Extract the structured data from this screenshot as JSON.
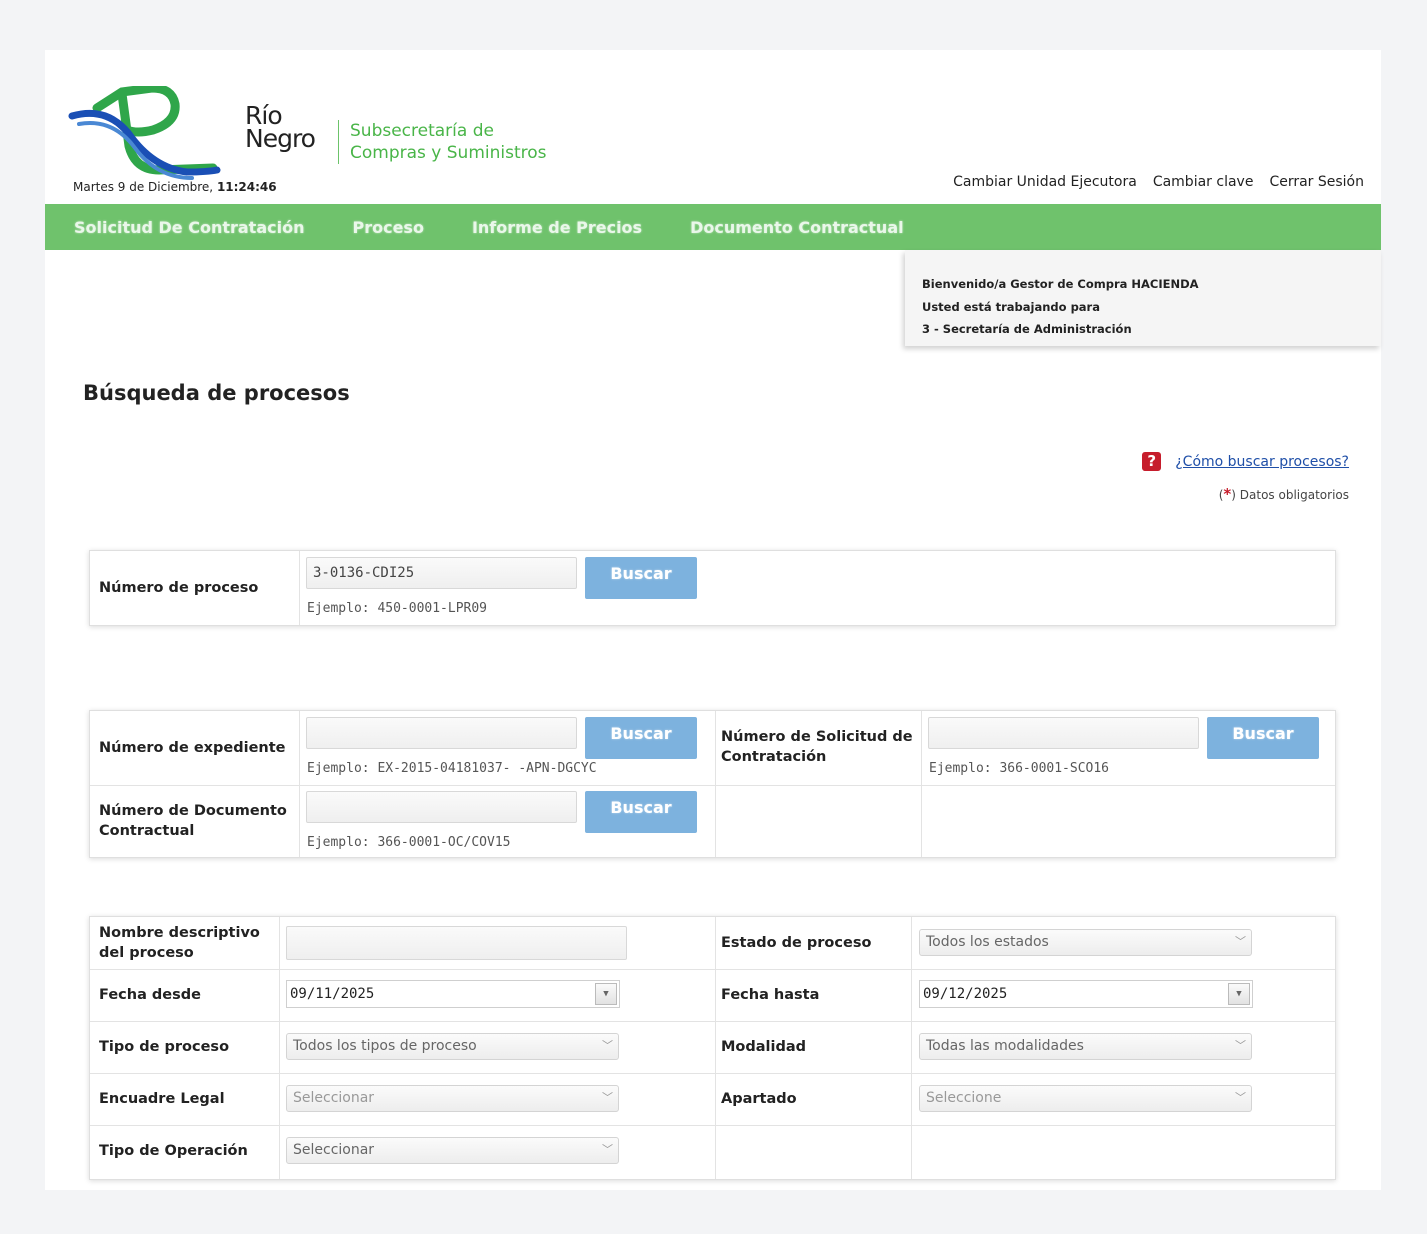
{
  "header": {
    "logo_word_line1": "Río",
    "logo_word_line2": "Negro",
    "subtitle_line1": "Subsecretaría de",
    "subtitle_line2": "Compras y Suministros",
    "date_text": "Martes 9 de Diciembre, ",
    "time_text": "11:24:46",
    "links": [
      "Cambiar Unidad Ejecutora",
      "Cambiar clave",
      "Cerrar Sesión"
    ]
  },
  "nav": [
    "Solicitud De Contratación",
    "Proceso",
    "Informe de Precios",
    "Documento Contractual"
  ],
  "welcome": {
    "line1": "Bienvenido/a Gestor de Compra HACIENDA",
    "line2": "Usted está trabajando para",
    "line3": "3 - Secretaría de Administración"
  },
  "page_title": "Búsqueda de procesos",
  "help": {
    "icon": "?",
    "link": "¿Cómo buscar procesos?",
    "required_open": "(",
    "required_star": "*",
    "required_text": ") Datos obligatorios"
  },
  "search_process": {
    "label": "Número de proceso",
    "value": "3-0136-CDI25",
    "hint": "Ejemplo: 450-0001-LPR09",
    "button": "Buscar"
  },
  "search_ids": {
    "expediente_label": "Número de expediente",
    "expediente_value": "",
    "expediente_hint": "Ejemplo: EX-2015-04181037- -APN-DGCYC",
    "expediente_button": "Buscar",
    "solicitud_label": "Número de Solicitud de Contratación",
    "solicitud_value": "",
    "solicitud_hint": "Ejemplo: 366-0001-SCO16",
    "solicitud_button": "Buscar",
    "documento_label": "Número de Documento Contractual",
    "documento_value": "",
    "documento_hint": "Ejemplo: 366-0001-OC/COV15",
    "documento_button": "Buscar"
  },
  "filters": {
    "nombre_label": "Nombre descriptivo del proceso",
    "nombre_value": "",
    "estado_label": "Estado de proceso",
    "estado_value": "Todos los estados",
    "fecha_desde_label": "Fecha desde",
    "fecha_desde_value": "09/11/2025",
    "fecha_hasta_label": "Fecha hasta",
    "fecha_hasta_value": "09/12/2025",
    "tipo_label": "Tipo de proceso",
    "tipo_value": "Todos los tipos de proceso",
    "modalidad_label": "Modalidad",
    "modalidad_value": "Todas las modalidades",
    "encuadre_label": "Encuadre Legal",
    "encuadre_value": "Seleccionar",
    "apartado_label": "Apartado",
    "apartado_value": "Seleccione",
    "operacion_label": "Tipo de Operación",
    "operacion_value": "Seleccionar"
  },
  "colors": {
    "brand_green": "#6fc26c",
    "button_blue": "#7db2de",
    "link_blue": "#1f4fa8",
    "required_red": "#c61d2c"
  }
}
